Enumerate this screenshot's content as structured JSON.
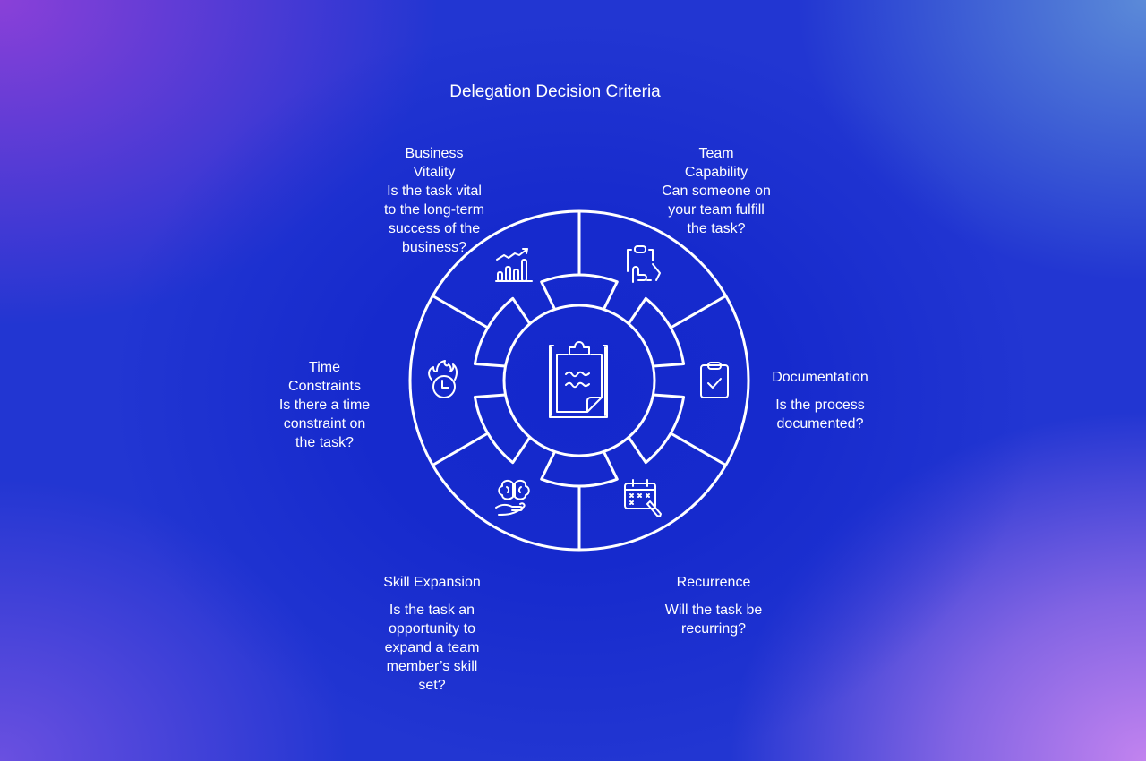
{
  "title": "Delegation Decision Criteria",
  "center": {
    "icon": "clipboard-notes-icon"
  },
  "criteria": [
    {
      "id": "team-capability",
      "heading": "Team\nCapability",
      "question": "Can someone on\nyour team fulfill\nthe task?",
      "icon": "clipboard-hand-icon"
    },
    {
      "id": "documentation",
      "heading": "Documentation",
      "question": "Is the process\ndocumented?",
      "icon": "clipboard-check-icon"
    },
    {
      "id": "recurrence",
      "heading": "Recurrence",
      "question": "Will the task be\nrecurring?",
      "icon": "calendar-pen-icon"
    },
    {
      "id": "skill-expansion",
      "heading": "Skill Expansion",
      "question": "Is the task an\nopportunity to\nexpand a team\nmember’s skill\nset?",
      "icon": "brain-hand-icon"
    },
    {
      "id": "time-constraints",
      "heading": "Time\nConstraints",
      "question": "Is there a time\nconstraint on\nthe task?",
      "icon": "burning-clock-icon"
    },
    {
      "id": "business-vitality",
      "heading": "Business\nVitality",
      "question": "Is the task vital\nto the long-term\nsuccess of the\nbusiness?",
      "icon": "growth-chart-icon"
    }
  ],
  "colors": {
    "line": "#ffffff",
    "core": "#1530d0"
  }
}
